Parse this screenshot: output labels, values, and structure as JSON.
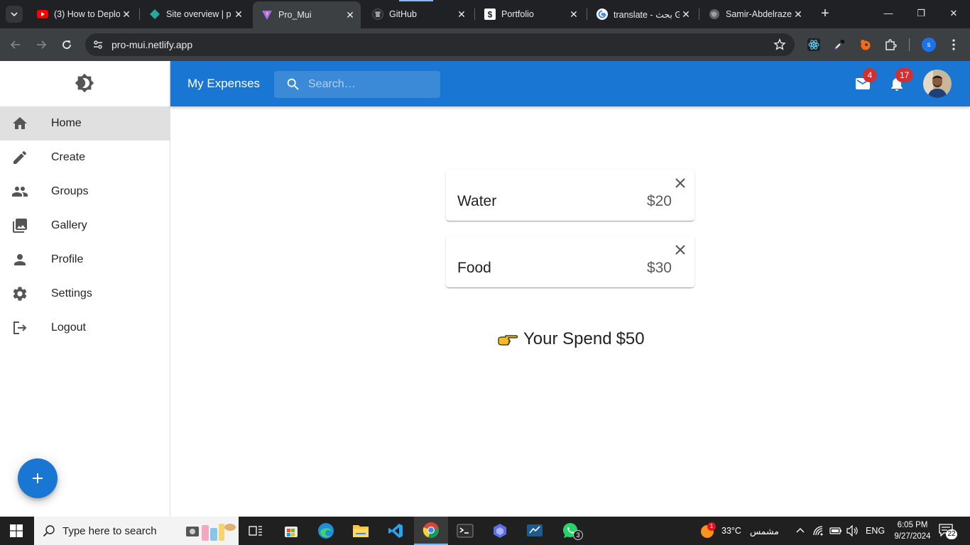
{
  "browser": {
    "tabs": [
      {
        "title": "(3) How to Deplo",
        "icon": "youtube-icon",
        "active": false
      },
      {
        "title": "Site overview | p",
        "icon": "netlify-icon",
        "active": false
      },
      {
        "title": "Pro_Mui",
        "icon": "vite-icon",
        "active": true
      },
      {
        "title": "GitHub",
        "icon": "github-icon",
        "active": false
      },
      {
        "title": "Portfolio",
        "icon": "portfolio-icon",
        "active": false
      },
      {
        "title": "translate - بحث G",
        "icon": "google-icon",
        "active": false
      },
      {
        "title": "Samir-Abdelraze",
        "icon": "globe-icon",
        "active": false
      }
    ],
    "url": "pro-mui.netlify.app",
    "profile_initial": "s",
    "window_controls": {
      "minimize": "—",
      "restore": "❐",
      "close": "✕"
    }
  },
  "app": {
    "brand": "My Expenses",
    "search_placeholder": "Search…",
    "mail_count": "4",
    "notification_count": "17",
    "accent_color": "#1976d2",
    "nav": [
      {
        "label": "Home",
        "icon": "home-icon",
        "selected": true
      },
      {
        "label": "Create",
        "icon": "pencil-icon",
        "selected": false
      },
      {
        "label": "Groups",
        "icon": "groups-icon",
        "selected": false
      },
      {
        "label": "Gallery",
        "icon": "gallery-icon",
        "selected": false
      },
      {
        "label": "Profile",
        "icon": "person-icon",
        "selected": false
      },
      {
        "label": "Settings",
        "icon": "gear-icon",
        "selected": false
      },
      {
        "label": "Logout",
        "icon": "logout-icon",
        "selected": false
      }
    ],
    "expenses": [
      {
        "name": "Water",
        "amount": "$20"
      },
      {
        "name": "Food",
        "amount": "$30"
      }
    ],
    "total": {
      "label": "Your Spend",
      "amount": "$50"
    }
  },
  "taskbar": {
    "search_text": "Type here to search",
    "apps": [
      "task-view",
      "store",
      "edge",
      "file-explorer",
      "vscode",
      "chrome",
      "terminal",
      "power-automate",
      "remote-desktop",
      "whatsapp"
    ],
    "whatsapp_count": "3",
    "weather_temp": "33°C",
    "weather_text": "مشمس",
    "weather_alert": "1",
    "language": "ENG",
    "time": "6:05 PM",
    "date": "9/27/2024",
    "notification_count": "22"
  }
}
